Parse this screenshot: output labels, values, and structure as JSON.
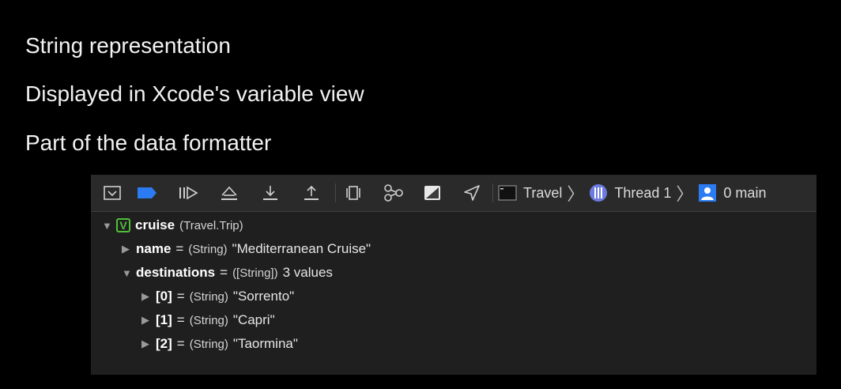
{
  "bullets": [
    "String representation",
    "Displayed in Xcode's variable view",
    "Part of the data formatter"
  ],
  "toolbar": {
    "icons": [
      "hide-debug-area-icon",
      "breakpoints-toggle-icon",
      "continue-icon",
      "step-over-icon",
      "step-into-icon",
      "step-out-icon",
      "view-hierarchy-icon",
      "memory-graph-icon",
      "environment-overrides-icon",
      "simulate-location-icon"
    ],
    "breadcrumb": {
      "target": "Travel",
      "thread": "Thread 1",
      "frame": "0 main"
    }
  },
  "variables": {
    "root": {
      "badge": "V",
      "name": "cruise",
      "type": "(Travel.Trip)"
    },
    "name_row": {
      "name": "name",
      "eq": "=",
      "type": "(String)",
      "value": "\"Mediterranean Cruise\""
    },
    "destinations_row": {
      "name": "destinations",
      "eq": "=",
      "type": "([String])",
      "value": "3 values"
    },
    "items": [
      {
        "name": "[0]",
        "eq": "=",
        "type": "(String)",
        "value": "\"Sorrento\""
      },
      {
        "name": "[1]",
        "eq": "=",
        "type": "(String)",
        "value": "\"Capri\""
      },
      {
        "name": "[2]",
        "eq": "=",
        "type": "(String)",
        "value": "\"Taormina\""
      }
    ]
  },
  "colors": {
    "accent_blue": "#2b7bf3",
    "badge_green": "#4fbf3a",
    "thread_purple": "#6c7be0"
  }
}
